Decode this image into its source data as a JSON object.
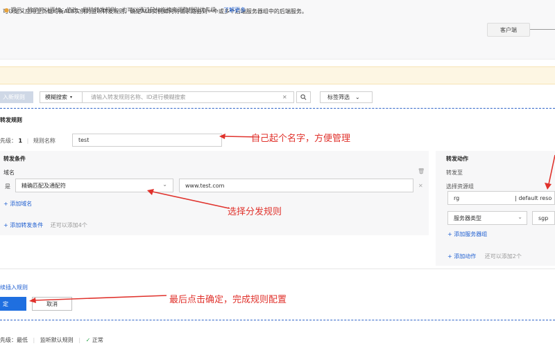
{
  "description": {
    "text": "可以定义应用型负载均衡ALB实例的监听转发规则，确定ALB实例如何将请求路由到一个或多个后端服务器组中的后端服务。",
    "client_label": "客户端"
  },
  "notice": {
    "icon": "info-circle-icon",
    "text": "提示：除了可以添加、修改、删除转发规则，也可以通过鼠标拖拽来调整规则优先级。",
    "link": "了解更多"
  },
  "toolbar": {
    "add_rule": "入新规则",
    "search_type": "模糊搜索",
    "search_placeholder": "请输入转发规则名称、ID进行模糊搜索",
    "tag_filter": "标签筛选"
  },
  "rule_form": {
    "title": "转发规则",
    "priority_label": "先级：",
    "priority_value": "1",
    "name_label": "规则名称",
    "name_value": "test",
    "conditions": {
      "title": "转发条件",
      "domain_label": "域名",
      "is_label": "是",
      "match_type": "精确匹配及通配符",
      "domain_value": "www.test.com",
      "add_domain": "+ 添加域名",
      "add_condition": "+ 添加转发条件",
      "condition_hint": "还可以添加4个"
    },
    "actions": {
      "title": "转发动作",
      "forward_to": "转发至",
      "select_group_label": "选择资源组",
      "group_value": "rg",
      "group_extra": "| default reso",
      "server_type": "服务器类型",
      "sgp": "sgp",
      "add_server_group": "+ 添加服务器组",
      "add_action": "+ 添加动作",
      "action_hint": "还可以添加2个"
    },
    "insert_rule": "续插入规则",
    "confirm": "定",
    "cancel": "取消"
  },
  "footer": {
    "priority_text": "先级：最低",
    "default_rule": "监听默认规则",
    "status": "正常"
  },
  "annotations": {
    "a1": "自己起个名字，方便管理",
    "a2": "选择分发规则",
    "a3": "最后点击确定，完成规则配置"
  },
  "colors": {
    "accent": "#1f6fe0",
    "annotation": "#e0322c",
    "notice_bg": "#fdf6e3"
  }
}
